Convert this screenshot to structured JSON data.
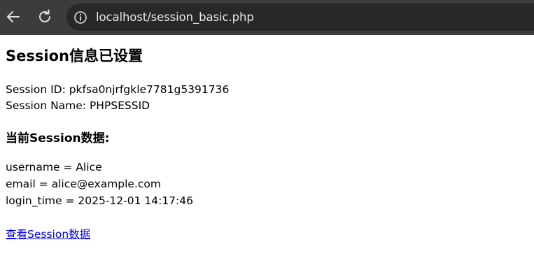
{
  "browser": {
    "url": "localhost/session_basic.php",
    "icons": {
      "back": "back-arrow-icon",
      "reload": "reload-icon",
      "site_info": "info-icon"
    }
  },
  "page": {
    "title": "Session信息已设置",
    "session_id_line": "Session ID: pkfsa0njrfgkle7781g5391736",
    "session_name_line": "Session Name: PHPSESSID",
    "data_heading": "当前Session数据:",
    "data_lines": [
      "username = Alice",
      "email = alice@example.com",
      "login_time = 2025-12-01 14:17:46"
    ],
    "link_label": "查看Session数据"
  },
  "colors": {
    "toolbar": "#3c3c3c",
    "address_bar": "#282828",
    "link": "#0000ee"
  }
}
